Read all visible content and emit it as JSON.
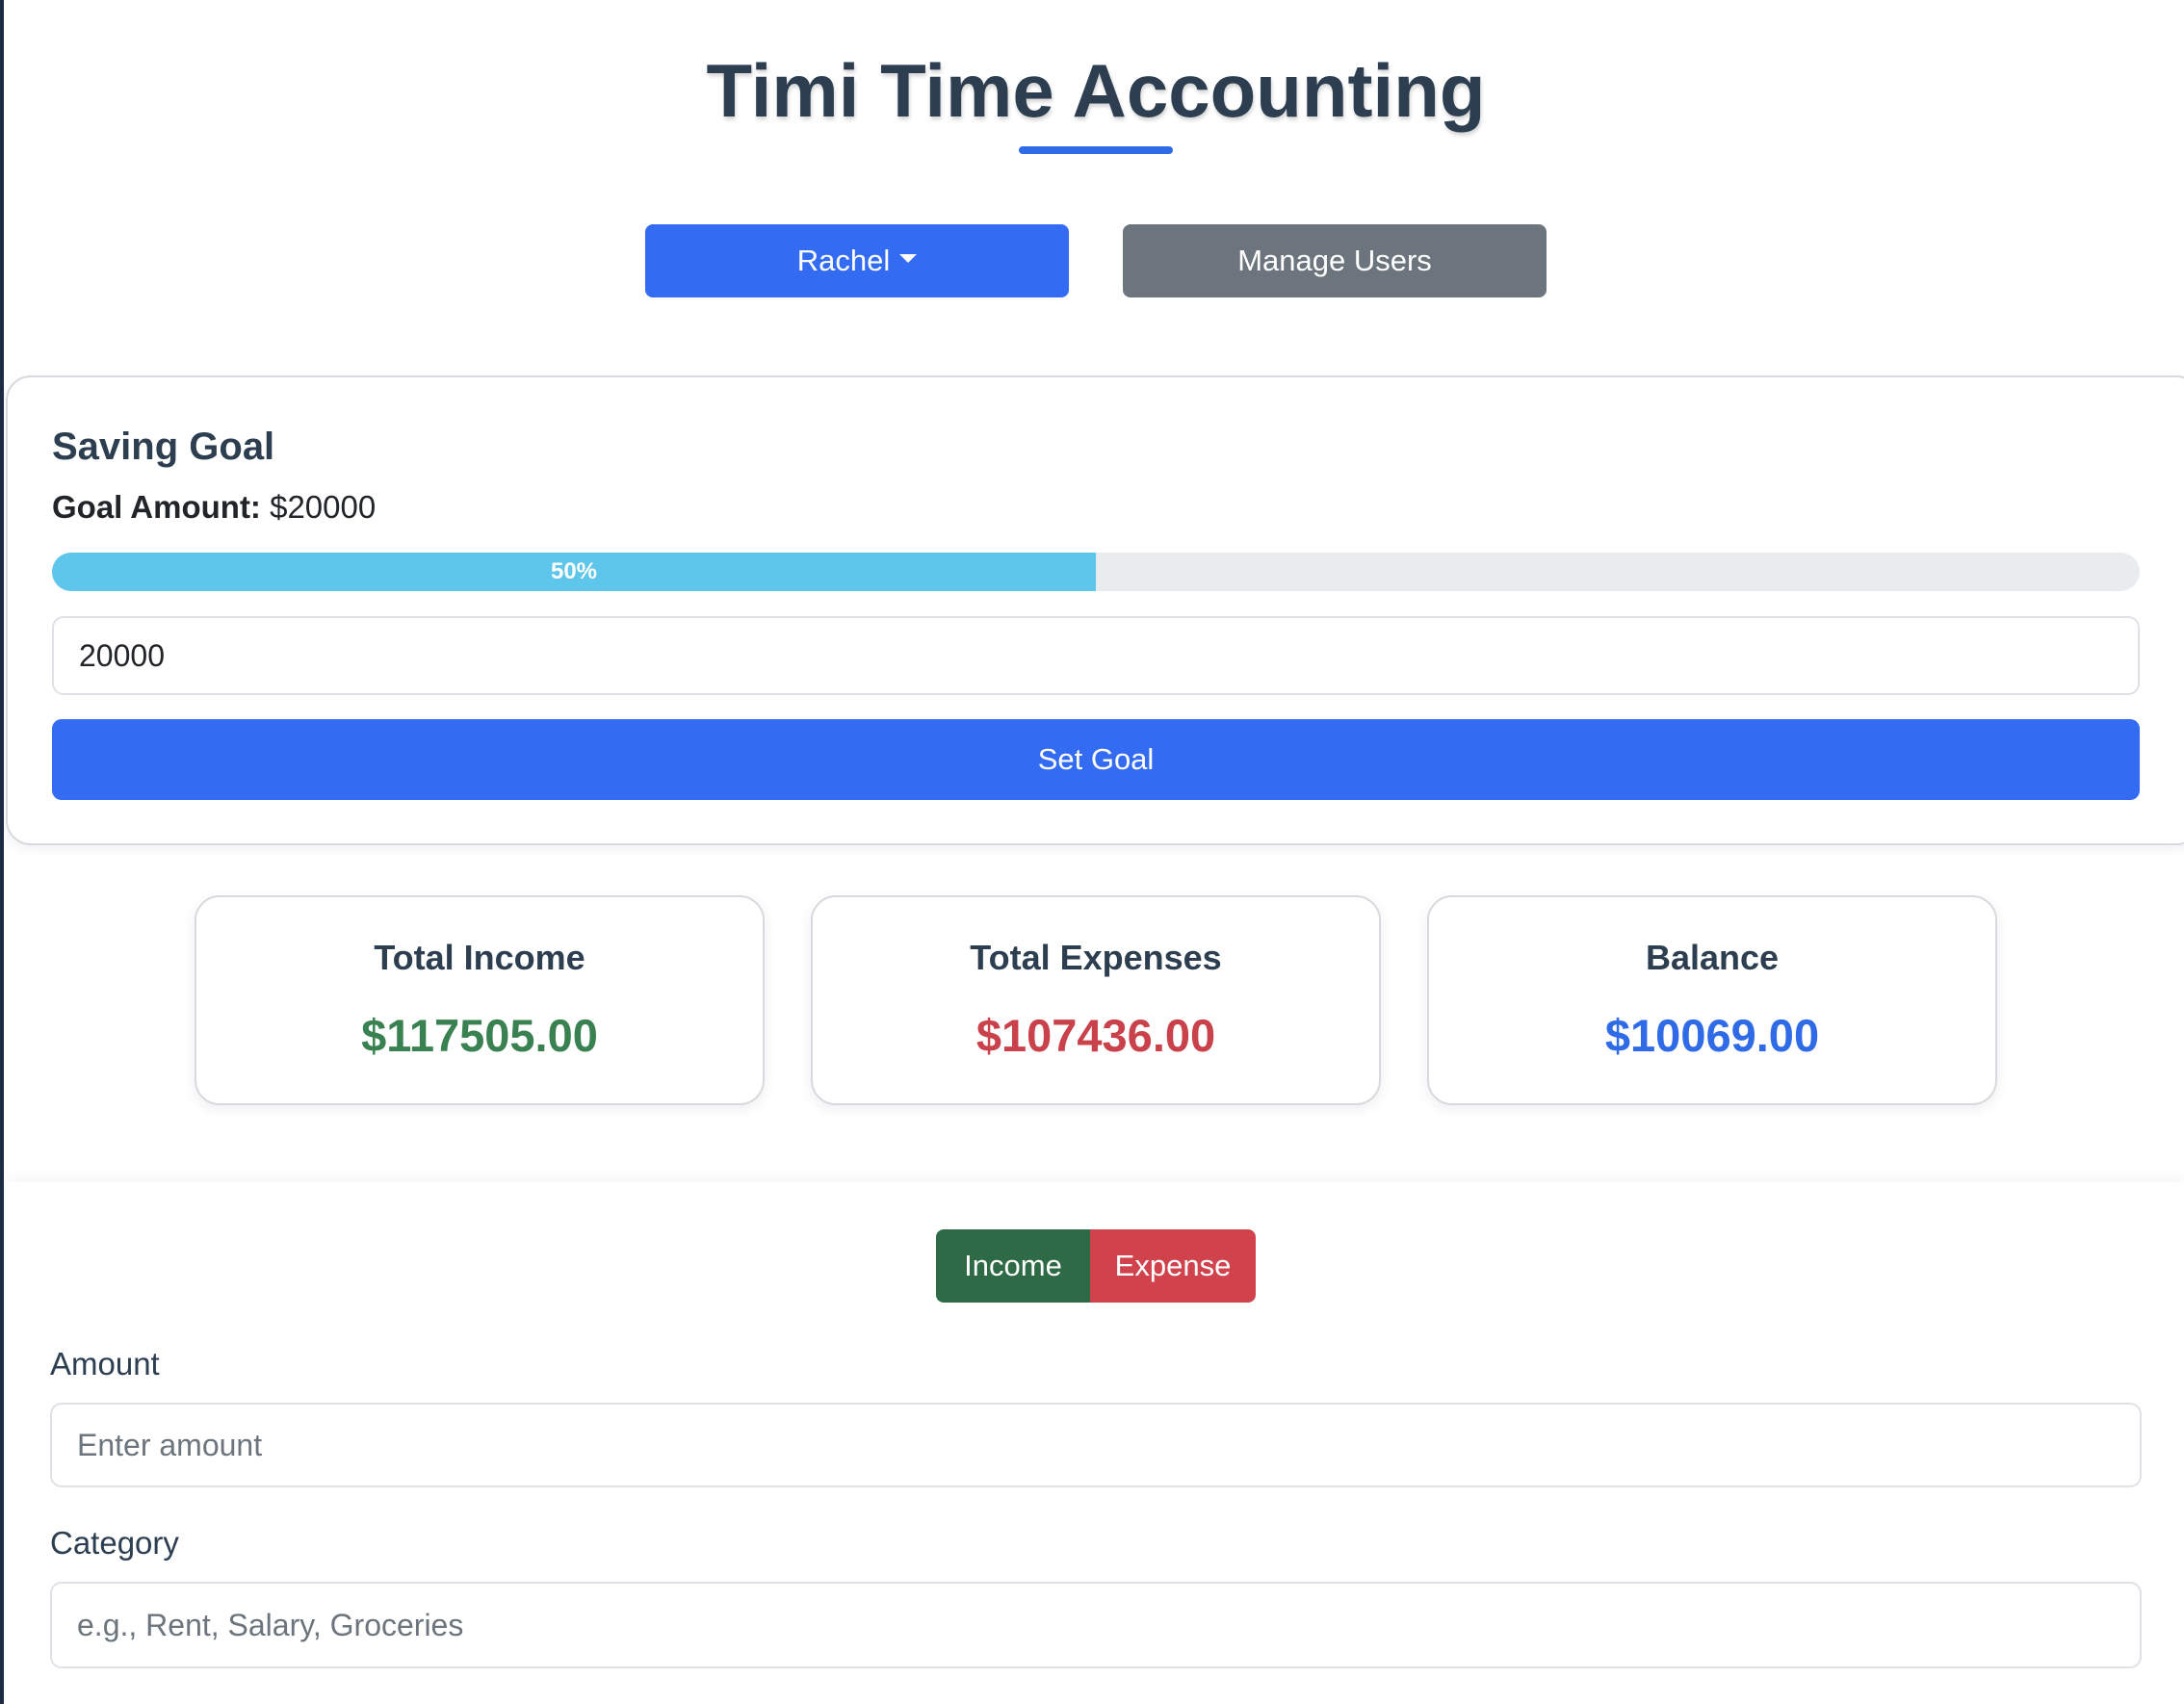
{
  "app": {
    "title": "Timi Time Accounting"
  },
  "header": {
    "user_dropdown_label": "Rachel",
    "manage_users_label": "Manage Users"
  },
  "saving_goal": {
    "title": "Saving Goal",
    "goal_amount_label": "Goal Amount:",
    "goal_amount_value": "$20000",
    "progress_text": "50%",
    "progress_fraction": 0.5,
    "input_value": "20000",
    "set_goal_label": "Set Goal"
  },
  "summary": {
    "income_label": "Total Income",
    "income_value": "$117505.00",
    "expenses_label": "Total Expenses",
    "expenses_value": "$107436.00",
    "balance_label": "Balance",
    "balance_value": "$10069.00"
  },
  "transaction_form": {
    "income_toggle_label": "Income",
    "expense_toggle_label": "Expense",
    "amount_label": "Amount",
    "amount_placeholder": "Enter amount",
    "category_label": "Category",
    "category_placeholder": "e.g., Rent, Salary, Groceries"
  },
  "colors": {
    "primary": "#336cf2",
    "secondary": "#6c757d",
    "income": "#3a8152",
    "expense": "#c9414b",
    "balance": "#2f6be6",
    "progress": "#5dc6ea"
  },
  "icons": {
    "dropdown_caret": "caret-down-icon"
  }
}
